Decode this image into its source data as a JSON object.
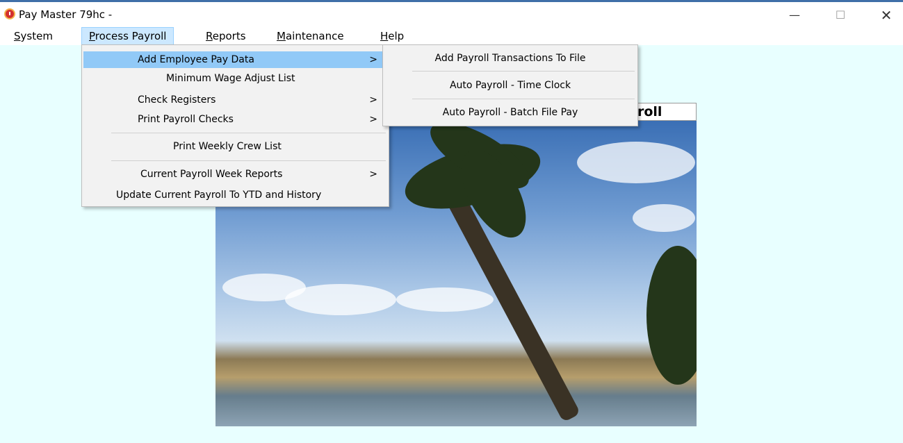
{
  "window": {
    "title": "Pay Master 79hc -",
    "minimize_glyph": "—",
    "maximize_glyph": "☐",
    "close_glyph": "✕"
  },
  "menubar": {
    "items": [
      {
        "label": "System",
        "mnemonic": "S",
        "rest": "ystem"
      },
      {
        "label": "Process Payroll",
        "mnemonic": "P",
        "rest": "rocess Payroll"
      },
      {
        "label": "Reports",
        "mnemonic": "R",
        "rest": "eports"
      },
      {
        "label": "Maintenance",
        "mnemonic": "M",
        "rest": "aintenance"
      },
      {
        "label": "Help",
        "mnemonic": "H",
        "rest": "elp"
      }
    ]
  },
  "process_payroll_menu": {
    "items": [
      {
        "label": "Add Employee Pay Data",
        "arrow": ">"
      },
      {
        "label": "Minimum Wage Adjust List",
        "arrow": ""
      },
      {
        "label": "Check Registers",
        "arrow": ">"
      },
      {
        "label": "Print Payroll Checks",
        "arrow": ">"
      },
      {
        "label": "Print Weekly Crew List",
        "arrow": ""
      },
      {
        "label": "Current Payroll Week Reports",
        "arrow": ">"
      },
      {
        "label": "Update Current Payroll To YTD and History",
        "arrow": ""
      }
    ]
  },
  "add_employee_pay_submenu": {
    "items": [
      {
        "label": "Add Payroll Transactions To File"
      },
      {
        "label": "Auto Payroll - Time Clock"
      },
      {
        "label": "Auto Payroll - Batch File Pay"
      }
    ]
  },
  "photo_header": {
    "visible_text": "roll"
  },
  "colors": {
    "client_background": "#e8ffff",
    "menu_highlight": "#91c9f7",
    "active_menu": "#cce8ff"
  }
}
